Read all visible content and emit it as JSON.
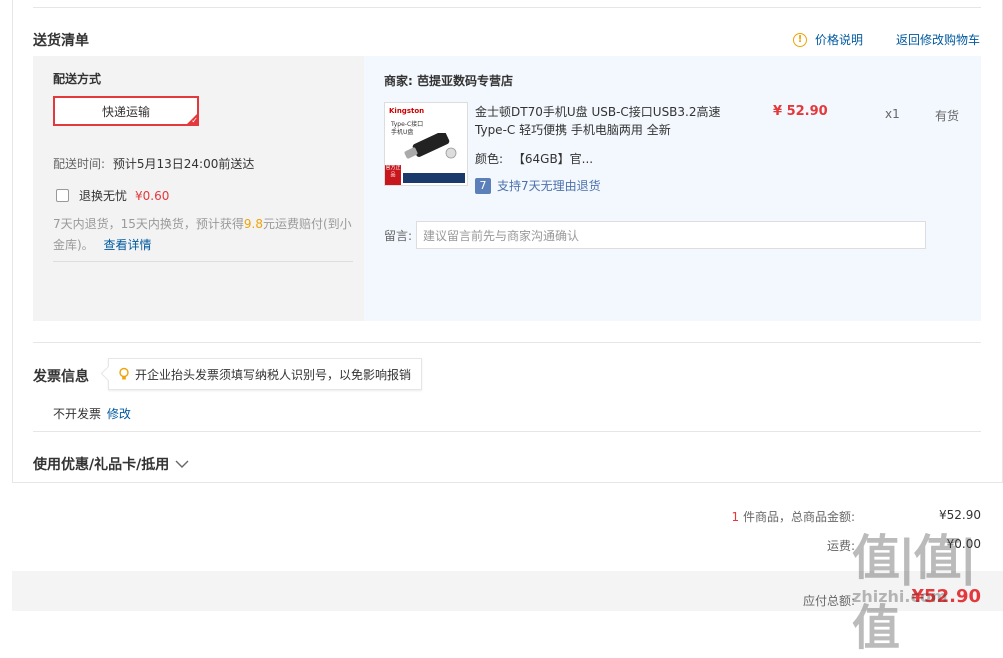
{
  "delivery_list": {
    "title": "送货清单",
    "price_note": "价格说明",
    "price_note_icon": "warning-icon",
    "back_to_cart": "返回修改购物车"
  },
  "shipping": {
    "heading": "配送方式",
    "method_label": "快递运输",
    "time_label": "配送时间:",
    "time_value": "预计5月13日24:00前送达",
    "return_insurance_label": "退换无忧",
    "return_insurance_price": "¥0.60",
    "return_insurance_checked": false,
    "insurance_desc_1": "7天内退货，15天内换货，预计获得",
    "insurance_desc_amount": "9.8",
    "insurance_desc_2": "元运费赔付(到小金库)。",
    "insurance_detail_link": "查看详情"
  },
  "merchant": {
    "label": "商家:",
    "name": "芭提亚数码专营店"
  },
  "goods": {
    "name": "金士顿DT70手机U盘 USB-C接口USB3.2高速Type-C 轻巧便携 手机电脑两用 全新",
    "price": "¥ 52.90",
    "quantity": "x1",
    "stock": "有货",
    "color_label": "颜色:",
    "color_value": "【64GB】官...",
    "return_policy_badge": "7",
    "return_policy_text": "支持7天无理由退货",
    "thumb_brand": "Kingston",
    "thumb_text_1": "Type-C接口",
    "thumb_text_2": "手机U盘",
    "thumb_tag": "官方正品"
  },
  "memo": {
    "label": "留言:",
    "placeholder": "建议留言前先与商家沟通确认"
  },
  "invoice": {
    "title": "发票信息",
    "tip": "开企业抬头发票须填写纳税人识别号，以免影响报销",
    "tip_icon": "lightbulb-icon",
    "status": "不开发票",
    "edit_link": "修改"
  },
  "discount": {
    "title": "使用优惠/礼品卡/抵用",
    "expand_icon": "chevron-down-icon"
  },
  "summary": {
    "item_count": "1",
    "item_count_label": "件商品，总商品金额:",
    "goods_total": "¥52.90",
    "freight_label": "运费:",
    "freight_value": "¥0.00",
    "payable_label": "应付总额:",
    "payable_value": "¥52.90"
  },
  "watermark": {
    "text": "值|值|值",
    "site": "zhizhi.com"
  },
  "colors": {
    "accent_red": "#e4393c",
    "link_blue": "#005aa0",
    "warning_orange": "#f0a30a",
    "panel_blue": "#f2f8fd"
  }
}
